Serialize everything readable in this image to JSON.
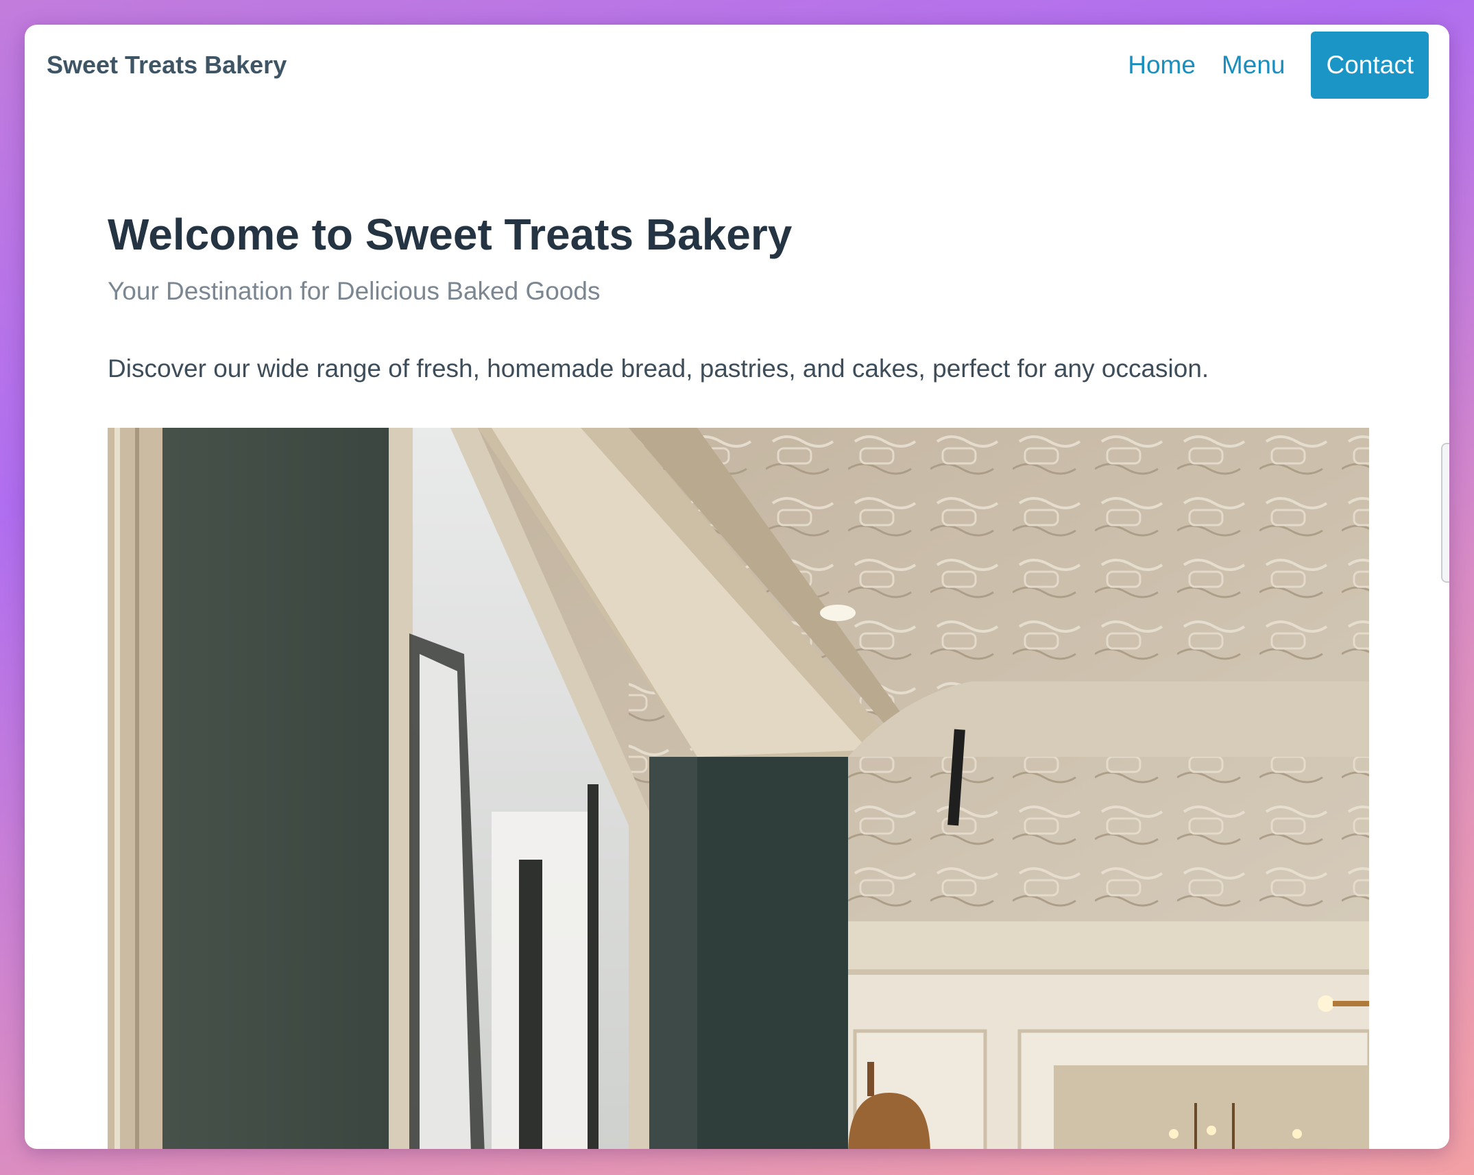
{
  "navbar": {
    "brand": "Sweet Treats Bakery",
    "links": [
      {
        "label": "Home"
      },
      {
        "label": "Menu"
      }
    ],
    "cta_label": "Contact"
  },
  "hero": {
    "title": "Welcome to Sweet Treats Bakery",
    "subtitle": "Your Destination for Delicious Baked Goods",
    "description": "Discover our wide range of fresh, homemade bread, pastries, and cakes, perfect for any occasion."
  },
  "colors": {
    "accent": "#1b95c6",
    "link": "#1a8fbf",
    "heading": "#253443",
    "muted": "#7a8792"
  }
}
